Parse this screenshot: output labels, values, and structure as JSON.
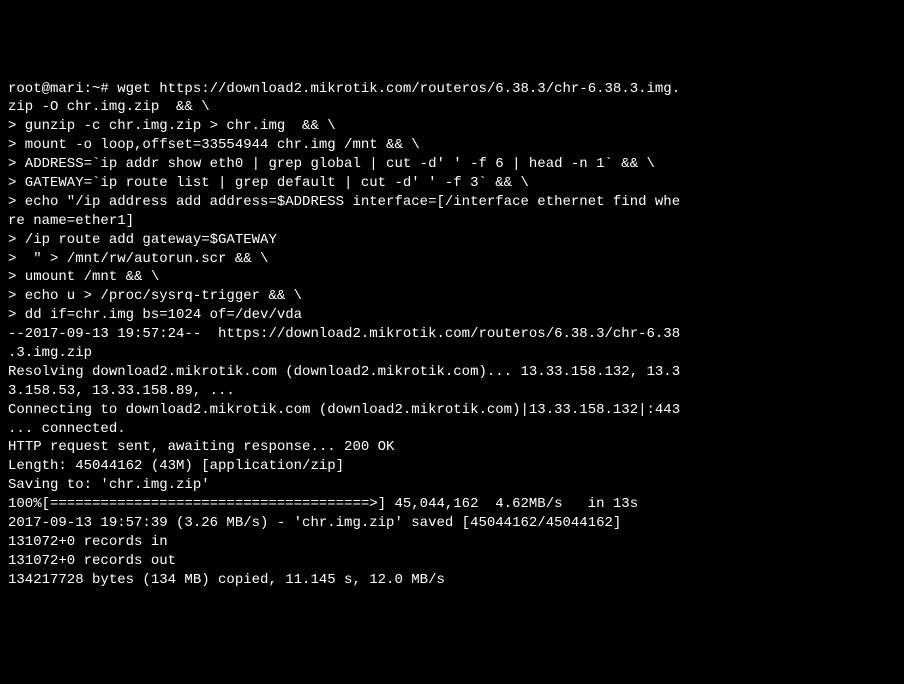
{
  "terminal": {
    "lines": [
      "root@mari:~# wget https://download2.mikrotik.com/routeros/6.38.3/chr-6.38.3.img.",
      "zip -O chr.img.zip  && \\",
      "> gunzip -c chr.img.zip > chr.img  && \\",
      "> mount -o loop,offset=33554944 chr.img /mnt && \\",
      "> ADDRESS=`ip addr show eth0 | grep global | cut -d' ' -f 6 | head -n 1` && \\",
      "> GATEWAY=`ip route list | grep default | cut -d' ' -f 3` && \\",
      "> echo \"/ip address add address=$ADDRESS interface=[/interface ethernet find whe",
      "re name=ether1]",
      "> /ip route add gateway=$GATEWAY",
      ">  \" > /mnt/rw/autorun.scr && \\",
      "> umount /mnt && \\",
      "> echo u > /proc/sysrq-trigger && \\",
      "> dd if=chr.img bs=1024 of=/dev/vda",
      "--2017-09-13 19:57:24--  https://download2.mikrotik.com/routeros/6.38.3/chr-6.38",
      ".3.img.zip",
      "Resolving download2.mikrotik.com (download2.mikrotik.com)... 13.33.158.132, 13.3",
      "3.158.53, 13.33.158.89, ...",
      "Connecting to download2.mikrotik.com (download2.mikrotik.com)|13.33.158.132|:443",
      "... connected.",
      "HTTP request sent, awaiting response... 200 OK",
      "Length: 45044162 (43M) [application/zip]",
      "Saving to: 'chr.img.zip'",
      "",
      "100%[======================================>] 45,044,162  4.62MB/s   in 13s",
      "",
      "2017-09-13 19:57:39 (3.26 MB/s) - 'chr.img.zip' saved [45044162/45044162]",
      "",
      "131072+0 records in",
      "131072+0 records out",
      "134217728 bytes (134 MB) copied, 11.145 s, 12.0 MB/s"
    ]
  }
}
